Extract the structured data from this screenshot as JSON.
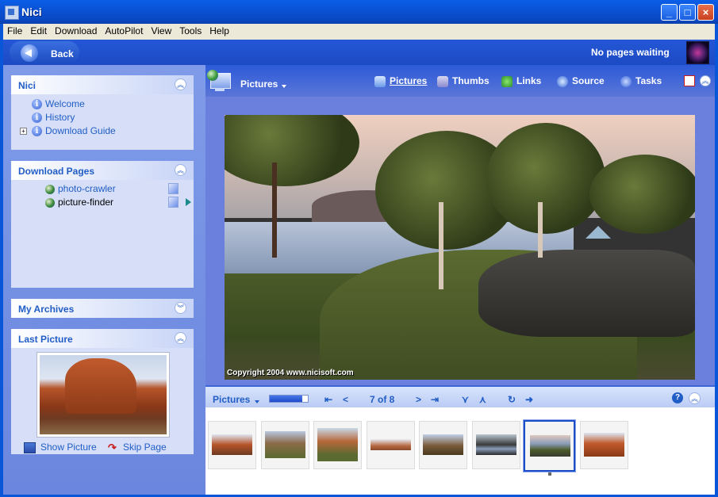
{
  "window": {
    "title": "Nici",
    "controls": [
      "_",
      "□",
      "×"
    ]
  },
  "menu": [
    "File",
    "Edit",
    "Download",
    "AutoPilot",
    "View",
    "Tools",
    "Help"
  ],
  "navbar": {
    "back_label": "Back",
    "status": "No pages waiting"
  },
  "panels": {
    "nici": {
      "title": "Nici",
      "items": [
        "Welcome",
        "History",
        "Download Guide"
      ]
    },
    "download_pages": {
      "title": "Download Pages",
      "items": [
        "photo-crawler",
        "picture-finder"
      ]
    },
    "archives": {
      "title": "My Archives"
    },
    "last_picture": {
      "title": "Last Picture",
      "show_label": "Show Picture",
      "skip_label": "Skip Page"
    }
  },
  "toolbar": {
    "view_label": "Pictures",
    "tabs": [
      "Pictures",
      "Thumbs",
      "Links",
      "Source",
      "Tasks"
    ],
    "active_tab": "Pictures"
  },
  "main_image": {
    "copyright": "Copyright 2004 www.nicisoft.com"
  },
  "bottombar": {
    "label": "Pictures",
    "counter": "7 of 8",
    "help": "?",
    "progress": 0.85
  },
  "thumbnails": {
    "count": 8,
    "selected_index": 6
  },
  "colors": {
    "accent": "#215dc6",
    "titlebar": "#0a56d8",
    "panel_bg": "#d6dff7"
  }
}
